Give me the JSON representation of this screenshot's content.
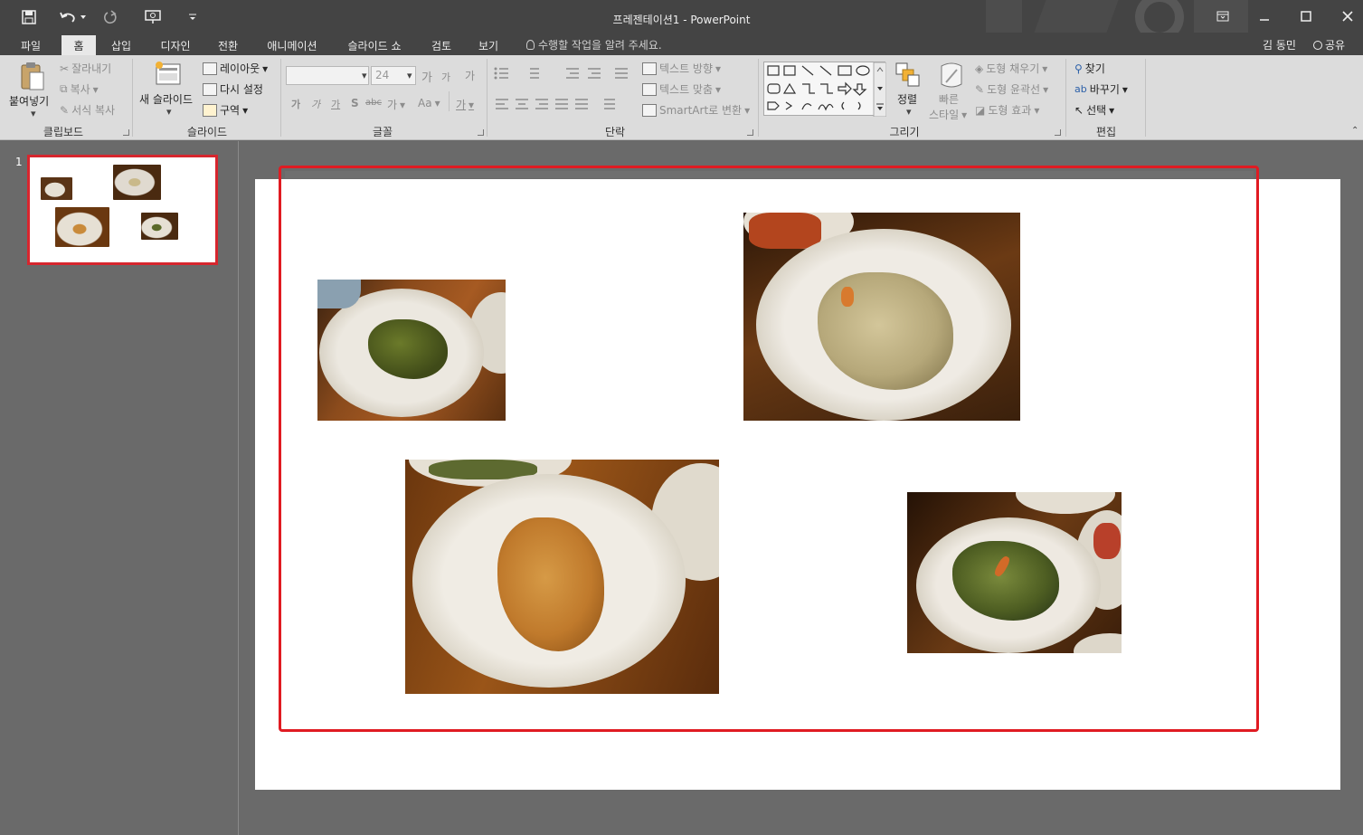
{
  "window": {
    "title": "프레젠테이션1 - PowerPoint",
    "quick_access": [
      "save-icon",
      "undo-icon",
      "redo-icon",
      "present-from-start-icon",
      "customize-icon"
    ],
    "controls": [
      "ribbon-display-icon",
      "minimize-icon",
      "maximize-icon",
      "close-icon"
    ]
  },
  "tabs": [
    {
      "label": "파일",
      "active": false
    },
    {
      "label": "홈",
      "active": true
    },
    {
      "label": "삽입",
      "active": false
    },
    {
      "label": "디자인",
      "active": false
    },
    {
      "label": "전환",
      "active": false
    },
    {
      "label": "애니메이션",
      "active": false
    },
    {
      "label": "슬라이드 쇼",
      "active": false
    },
    {
      "label": "검토",
      "active": false
    },
    {
      "label": "보기",
      "active": false
    }
  ],
  "tell_me": "수행할 작업을 알려 주세요.",
  "user": "김 동민",
  "share": "공유",
  "ribbon": {
    "clipboard": {
      "label": "클립보드",
      "paste": "붙여넣기",
      "cut": "잘라내기",
      "copy": "복사",
      "format_painter": "서식 복사"
    },
    "slides": {
      "label": "슬라이드",
      "new_slide": "새 슬라이드",
      "layout": "레이아웃",
      "reset": "다시 설정",
      "section": "구역"
    },
    "font": {
      "label": "글꼴",
      "font_name": "",
      "font_size": "24",
      "grow": "가",
      "shrink": "가",
      "clear": "가",
      "bold": "가",
      "italic": "가",
      "underline": "가",
      "shadow": "S",
      "strike": "abc",
      "spacing": "가",
      "case": "Aa",
      "color": "가"
    },
    "paragraph": {
      "label": "단락",
      "text_direction": "텍스트 방향",
      "align_text": "텍스트 맞춤",
      "smartart": "SmartArt로 변환"
    },
    "drawing": {
      "label": "그리기",
      "arrange": "정렬",
      "quick_styles_1": "빠른",
      "quick_styles_2": "스타일",
      "fill": "도형 채우기",
      "outline": "도형 윤곽선",
      "effects": "도형 효과"
    },
    "editing": {
      "label": "편집",
      "find": "찾기",
      "replace": "바꾸기",
      "select": "선택"
    }
  },
  "thumbnails": [
    {
      "number": "1"
    }
  ],
  "slide": {
    "photos": [
      {
        "name": "photo-pickled-peppers",
        "subject": "green pickled peppers side dish"
      },
      {
        "name": "photo-braised-root",
        "subject": "braised root vegetable side dish"
      },
      {
        "name": "photo-fishcake-stirfry",
        "subject": "stir-fried fish cake side dish"
      },
      {
        "name": "photo-seaweed-salad",
        "subject": "seaweed stem salad side dish"
      }
    ]
  }
}
